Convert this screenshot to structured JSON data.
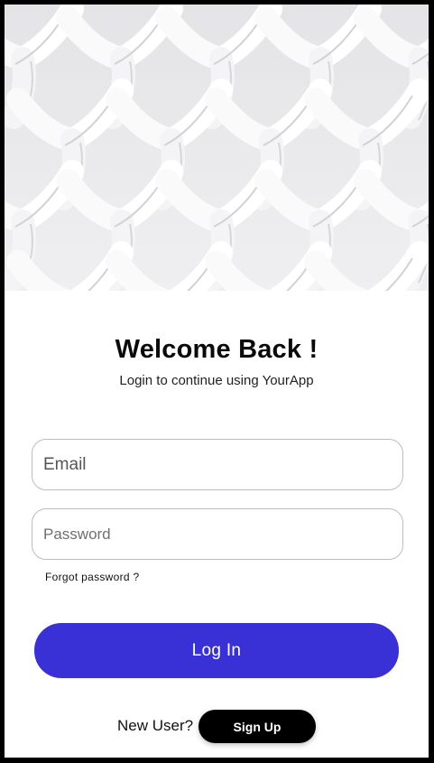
{
  "header": {
    "image": "woven-white-lattice-pattern"
  },
  "login": {
    "title": "Welcome Back !",
    "subtitle": "Login to continue using YourApp",
    "email_placeholder": "Email",
    "password_placeholder": "Password",
    "forgot_label": "Forgot password ?",
    "login_label": "Log In",
    "new_user_label": "New User?",
    "signup_label": "Sign Up"
  },
  "colors": {
    "accent": "#3930d6",
    "signup_bg": "#000000",
    "background": "#ffffff",
    "frame": "#000000"
  }
}
